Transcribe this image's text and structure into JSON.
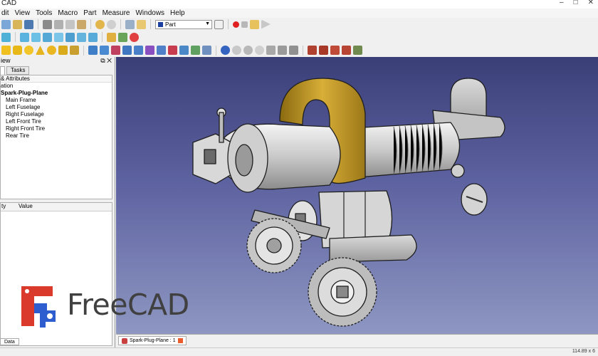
{
  "window": {
    "title": "CAD",
    "controls": [
      "–",
      "□",
      "✕"
    ]
  },
  "menu": [
    "dit",
    "View",
    "Tools",
    "Macro",
    "Part",
    "Measure",
    "Windows",
    "Help"
  ],
  "toolbar": {
    "workbench": "Part",
    "icons_row1": [
      "new-icon",
      "open-icon",
      "save-icon",
      "print-icon",
      "cut-icon",
      "copy-icon",
      "paste-icon",
      "undo-icon",
      "redo-icon",
      "refresh-icon",
      "edit-icon",
      "whats-this-icon"
    ],
    "icons_row2": [
      "fit-all-icon",
      "front-view-icon",
      "top-view-icon",
      "right-view-icon",
      "axo-icon",
      "rear-view-icon",
      "bottom-view-icon",
      "left-view-icon",
      "measure-icon",
      "clip-icon"
    ],
    "macro_icons": [
      "record-macro-icon",
      "stop-macro-icon",
      "macro-edit-icon",
      "run-macro-icon"
    ]
  },
  "panel": {
    "header": "iew",
    "tabs": [
      "",
      "Tasks"
    ],
    "labels_header": "& Attributes",
    "application_label": "ation",
    "document": "Spark-Plug-Plane",
    "items": [
      "Main Frame",
      "Left Fuselage",
      "Right Fuselage",
      "Left Front Tire",
      "Right Front Tire",
      "Rear Tire"
    ],
    "property_header": [
      "ty",
      "Value"
    ],
    "data_tab": "Data"
  },
  "document_tab": {
    "label": "Spark-Plug-Plane : 1"
  },
  "status": {
    "dimensions": "114.89 x 6"
  },
  "logo": {
    "text": "FreeCAD"
  },
  "colors": {
    "viewport_top": "#3b3f78",
    "viewport_bottom": "#8e97c2",
    "logo_red": "#d93a2b",
    "logo_blue": "#2d5dcf",
    "part_gold": "#c19a2c"
  }
}
